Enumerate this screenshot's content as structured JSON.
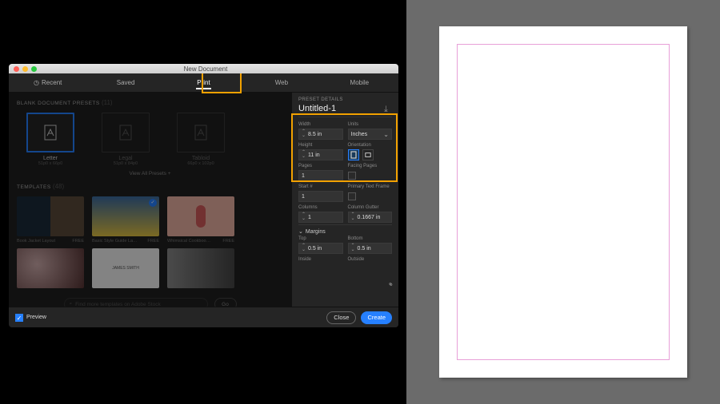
{
  "titlebar": {
    "title": "New Document"
  },
  "tabs": [
    {
      "icon": "◷",
      "label": "Recent"
    },
    {
      "icon": "",
      "label": "Saved"
    },
    {
      "icon": "",
      "label": "Print"
    },
    {
      "icon": "",
      "label": "Web"
    },
    {
      "icon": "",
      "label": "Mobile"
    }
  ],
  "presets_section": {
    "label": "BLANK DOCUMENT PRESETS",
    "count": "(11)"
  },
  "presets": [
    {
      "name": "Letter",
      "dims": "51p0 x 66p0"
    },
    {
      "name": "Legal",
      "dims": "51p0 x 84p0"
    },
    {
      "name": "Tabloid",
      "dims": "66p0 x 102p0"
    }
  ],
  "view_all": "View All Presets  +",
  "templates_section": {
    "label": "TEMPLATES",
    "count": "(48)"
  },
  "templates": [
    {
      "name": "Book Jacket Layout",
      "price": "FREE"
    },
    {
      "name": "Basic Style Guide La…",
      "price": "FREE"
    },
    {
      "name": "Whimsical Cookboo…",
      "price": "FREE"
    }
  ],
  "search": {
    "placeholder": "Find more templates on Adobe Stock",
    "go": "Go"
  },
  "details": {
    "head": "PRESET DETAILS",
    "doc_name": "Untitled-1",
    "width_lbl": "Width",
    "width": "8.5 in",
    "units_lbl": "Units",
    "units": "Inches",
    "height_lbl": "Height",
    "height": "11 in",
    "orient_lbl": "Orientation",
    "pages_lbl": "Pages",
    "pages": "1",
    "facing_lbl": "Facing Pages",
    "start_lbl": "Start #",
    "start": "1",
    "ptf_lbl": "Primary Text Frame",
    "columns_lbl": "Columns",
    "columns": "1",
    "gutter_lbl": "Column Gutter",
    "gutter": "0.1667 in",
    "margins_lbl": "Margins",
    "top_lbl": "Top",
    "top": "0.5 in",
    "bottom_lbl": "Bottom",
    "bottom": "0.5 in",
    "inside_lbl": "Inside",
    "outside_lbl": "Outside"
  },
  "footer": {
    "preview": "Preview",
    "close": "Close",
    "create": "Create"
  }
}
